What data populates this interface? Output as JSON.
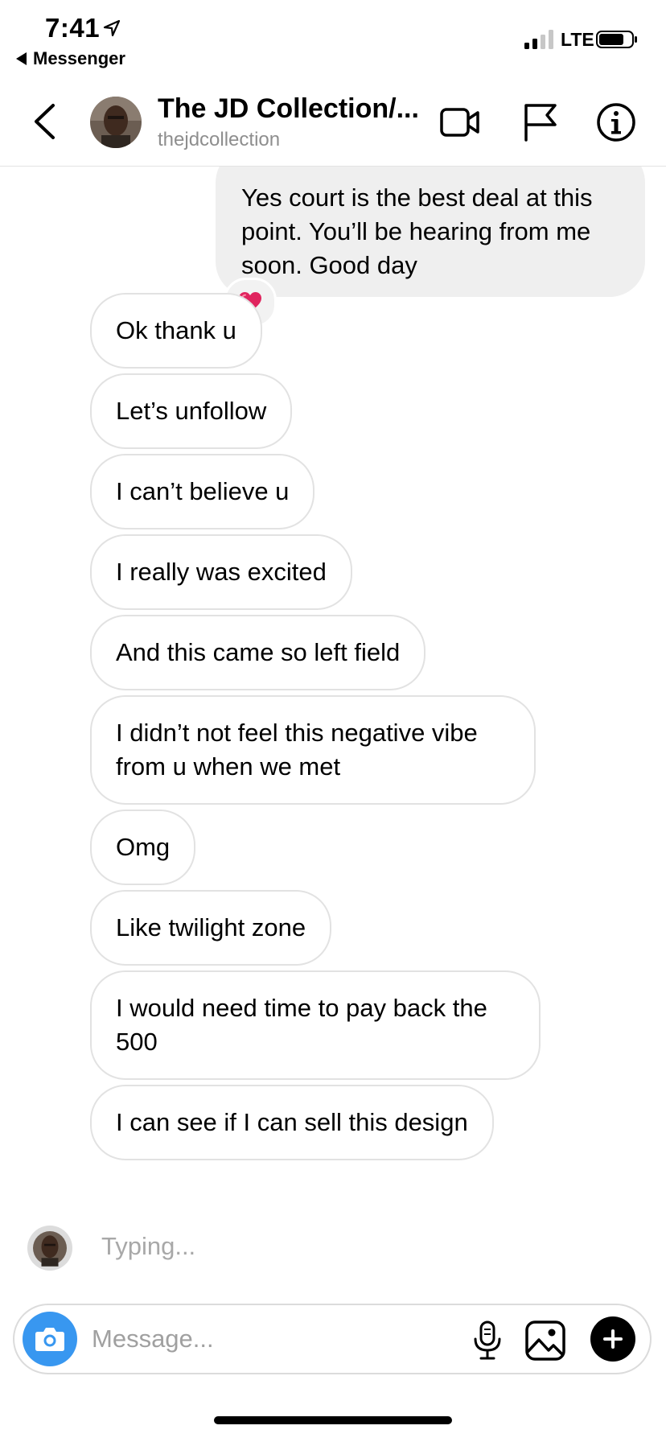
{
  "status_bar": {
    "time": "7:41",
    "back_app": "Messenger",
    "network": "LTE"
  },
  "header": {
    "name": "The JD Collection/...",
    "handle": "thejdcollection"
  },
  "thread": {
    "outgoing": {
      "text": "Yes court is the best deal at this point. You’ll be hearing from me soon. Good day",
      "reaction": "❤️"
    },
    "incoming": [
      "Ok thank u",
      "Let’s unfollow",
      "I can’t believe u",
      "I really was excited",
      "And this came so left field",
      "I didn’t not feel this negative vibe from u when we met",
      "Omg",
      "Like twilight zone",
      "I would need time to pay back the 500",
      "I can see if I can sell this design"
    ],
    "typing": "Typing..."
  },
  "composer": {
    "placeholder": "Message..."
  },
  "colors": {
    "accent": "#3897f0",
    "outgoing_bubble": "#efefef",
    "bubble_border": "#e2e2e2",
    "muted_text": "#8e8e8e"
  },
  "icons": {
    "location": "location-arrow-icon",
    "back": "chevron-left-icon",
    "video": "video-camera-icon",
    "flag": "flag-icon",
    "info": "info-icon",
    "camera": "camera-icon",
    "mic": "microphone-icon",
    "gallery": "gallery-icon",
    "plus": "plus-icon"
  }
}
